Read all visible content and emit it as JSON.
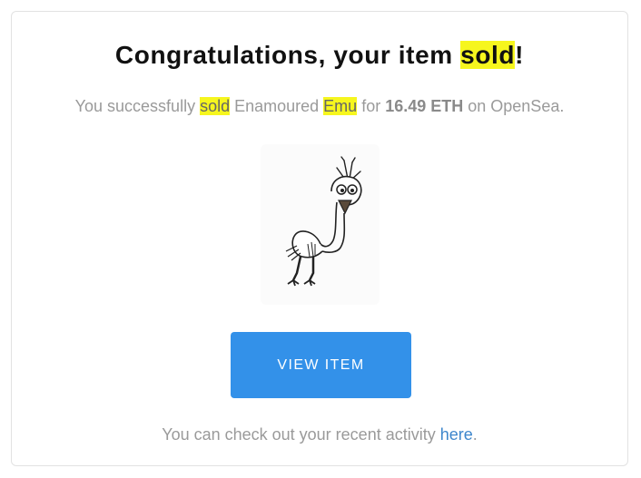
{
  "email": {
    "title": {
      "prefix": "Congratulations, your item ",
      "highlight": "sold",
      "suffix": "!"
    },
    "message": {
      "part1": "You successfully ",
      "sold": "sold",
      "part2": " Enamoured ",
      "emu": "Emu",
      "part3": " for ",
      "price": "16.49 ETH",
      "part4": " on OpenSea."
    },
    "item_image": {
      "icon": "emu-drawing-image"
    },
    "view_button": "VIEW ITEM",
    "footer": {
      "text": "You can check out your recent activity ",
      "link": "here",
      "suffix": "."
    }
  },
  "colors": {
    "highlight": "#f6f61e",
    "button": "#3391e9",
    "link": "#3d86cc",
    "muted_text": "#9a9a9a"
  }
}
